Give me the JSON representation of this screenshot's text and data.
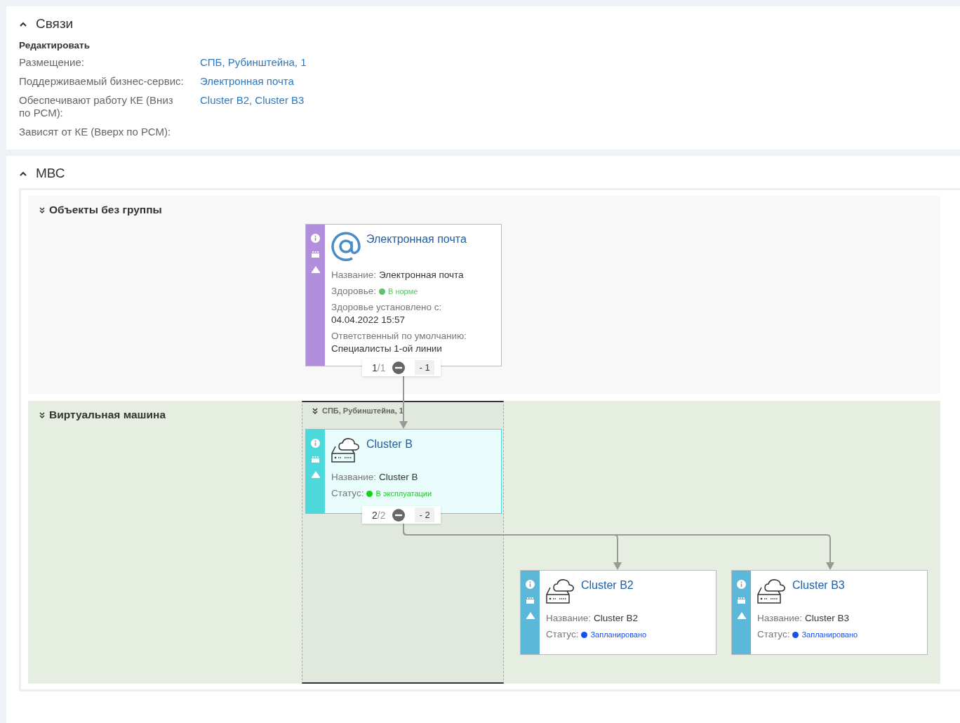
{
  "relations": {
    "title": "Связи",
    "expanded": true,
    "edit_link": "Редактировать",
    "rows": [
      {
        "label": "Размещение:",
        "value": "СПБ, Рубинштейна, 1"
      },
      {
        "label": "Поддерживаемый бизнес-сервис:",
        "value": "Электронная почта"
      },
      {
        "label": "Обеспечивают работу КЕ (Вниз по РСМ):",
        "value": "Cluster B2, Cluster B3"
      },
      {
        "label": "Зависят от КЕ (Вверх по РСМ):"
      }
    ]
  },
  "mbc": {
    "title": "МВС",
    "expanded": true,
    "lanes": [
      {
        "title": "Объекты без группы",
        "color": "#f8f8f8"
      },
      {
        "title": "Виртуальная машина",
        "color": "#e6eee1",
        "group": {
          "title": "СПБ, Рубинштейна, 1"
        }
      }
    ],
    "nodes": [
      {
        "kind": "email",
        "title": "Электронная почта",
        "color": "#b18fdd",
        "selected": false,
        "fields": [
          {
            "kind": "inline",
            "label": "Название:",
            "value": "Электронная почта"
          },
          {
            "kind": "status",
            "label": "Здоровье:",
            "value": "В норме",
            "color": "#5ec26a"
          },
          {
            "kind": "block",
            "label": "Здоровье установлено с:",
            "value": "04.04.2022 15:57"
          },
          {
            "kind": "block",
            "label": "Ответственный по умолчанию:",
            "value": "Специалисты 1-ой линии"
          }
        ],
        "counter": {
          "current": "1",
          "total": "/1",
          "delta": "- 1"
        }
      },
      {
        "kind": "server",
        "title": "Cluster B",
        "color": "#4dd9dc",
        "selected": true,
        "fields": [
          {
            "kind": "inline",
            "label": "Название:",
            "value": "Cluster B"
          },
          {
            "kind": "status",
            "label": "Статус:",
            "value": "В эксплуатации",
            "color": "#12d412"
          }
        ],
        "counter": {
          "current": "2",
          "total": "/2",
          "delta": "- 2"
        }
      },
      {
        "kind": "server",
        "title": "Cluster B2",
        "color": "#5bb8d8",
        "selected": false,
        "fields": [
          {
            "kind": "inline",
            "label": "Название:",
            "value": "Cluster B2"
          },
          {
            "kind": "status",
            "label": "Статус:",
            "value": "Запланировано",
            "color": "#1450f0"
          }
        ]
      },
      {
        "kind": "server",
        "title": "Cluster B3",
        "color": "#5bb8d8",
        "selected": false,
        "fields": [
          {
            "kind": "inline",
            "label": "Название:",
            "value": "Cluster B3"
          },
          {
            "kind": "status",
            "label": "Статус:",
            "value": "Запланировано",
            "color": "#1450f0"
          }
        ]
      }
    ]
  }
}
